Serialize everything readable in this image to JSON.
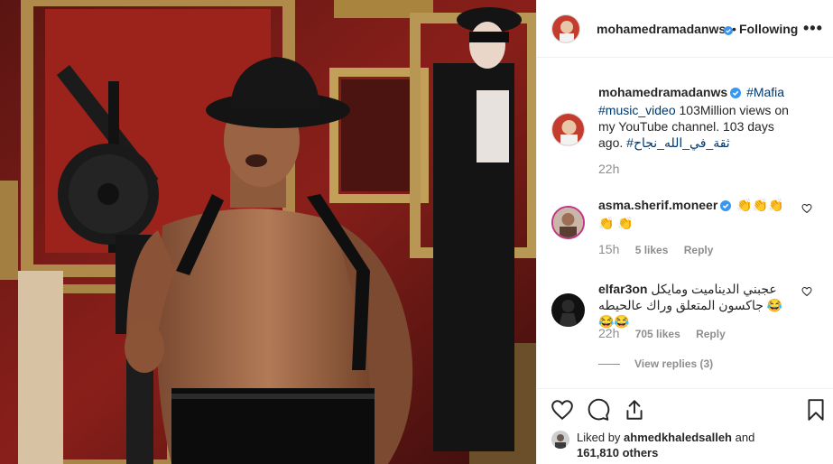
{
  "header": {
    "username": "mohamedramadanws",
    "separator": "•",
    "follow_status": "Following",
    "more": "•••"
  },
  "caption": {
    "username": "mohamedramadanws",
    "hashtag_1": "#Mafia",
    "hashtag_2": "#music_video",
    "text": " 103Million views on my YouTube channel. 103 days ago.",
    "hashtag_3": "#ثقة_في_الله_نجاح",
    "time": "22h"
  },
  "comments": [
    {
      "username": "asma.sherif.moneer",
      "text": "👏👏👏👏 👏",
      "time": "15h",
      "likes": "5 likes",
      "reply": "Reply"
    },
    {
      "username": "elfar3on",
      "text": "عجبني الديناميت ومايكل جاكسون المتعلق وراك عالحيطه 😂😂😂",
      "time": "22h",
      "likes": "705 likes",
      "reply": "Reply",
      "view_replies": "View replies (3)"
    }
  ],
  "likes": {
    "prefix": "Liked by ",
    "user": "ahmedkhaledsalleh",
    "middle": " and",
    "count": "161,810 others"
  },
  "colors": {
    "verified": "#3897f0",
    "link": "#00376b",
    "muted": "#8e8e8e",
    "text": "#262626"
  },
  "icons": {
    "like": "heart-outline-icon",
    "comment": "speech-bubble-icon",
    "share": "share-upload-icon",
    "save": "bookmark-icon"
  }
}
